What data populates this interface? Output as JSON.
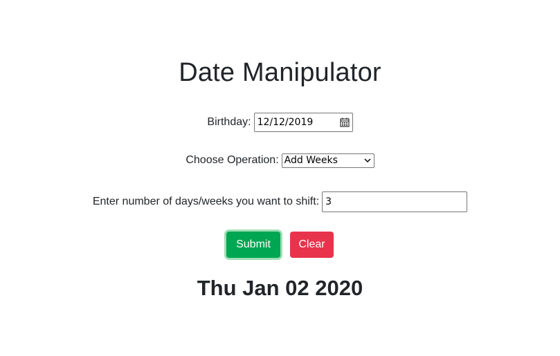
{
  "header": {
    "title": "Date Manipulator"
  },
  "form": {
    "birthday": {
      "label": "Birthday:",
      "value": "12/12/2019"
    },
    "operation": {
      "label": "Choose Operation:",
      "selected": "Add Weeks"
    },
    "shift": {
      "label": "Enter number of days/weeks you want to shift:",
      "value": "3"
    },
    "submit_label": "Submit",
    "clear_label": "Clear"
  },
  "result": {
    "text": "Thu Jan 02 2020"
  },
  "colors": {
    "submit": "#00a651",
    "clear": "#e8334d",
    "text": "#212529"
  }
}
